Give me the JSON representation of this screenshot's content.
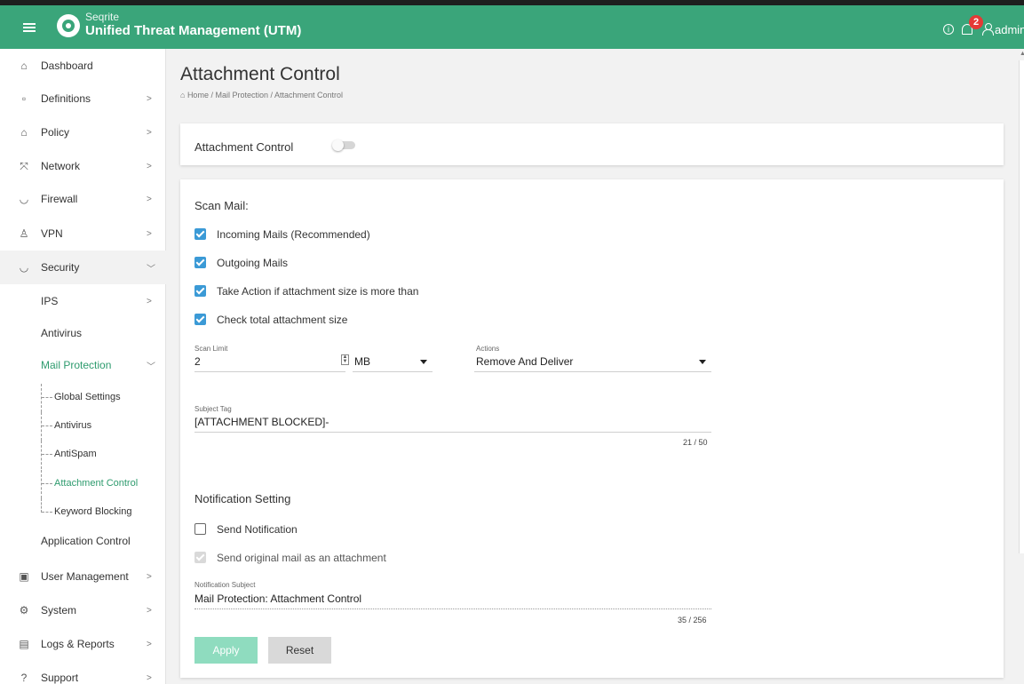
{
  "header": {
    "brand": "Seqrite",
    "product": "Unified Threat Management (UTM)",
    "notification_count": "2",
    "username": "admin",
    "info_glyph": "i"
  },
  "sidebar": {
    "items": [
      {
        "label": "Dashboard",
        "icon": "home-icon"
      },
      {
        "label": "Definitions",
        "icon": "file-icon"
      },
      {
        "label": "Policy",
        "icon": "home-icon"
      },
      {
        "label": "Network",
        "icon": "network-icon"
      },
      {
        "label": "Firewall",
        "icon": "shield-icon"
      },
      {
        "label": "VPN",
        "icon": "vpn-icon"
      },
      {
        "label": "Security",
        "icon": "shield-icon"
      }
    ],
    "security_sub": {
      "ips": "IPS",
      "antivirus": "Antivirus",
      "mail_protection": "Mail Protection",
      "mail_children": [
        "Global Settings",
        "Antivirus",
        "AntiSpam",
        "Attachment Control",
        "Keyword Blocking"
      ],
      "application_control": "Application Control"
    },
    "bottom_items": [
      {
        "label": "User Management",
        "icon": "user-box-icon"
      },
      {
        "label": "System",
        "icon": "gear-icon"
      },
      {
        "label": "Logs & Reports",
        "icon": "report-icon"
      },
      {
        "label": "Support",
        "icon": "help-icon"
      }
    ]
  },
  "page": {
    "title": "Attachment Control",
    "breadcrumb": "Home / Mail Protection / Attachment Control"
  },
  "toggle_card": {
    "label": "Attachment Control",
    "enabled": false
  },
  "scan": {
    "section_title": "Scan Mail:",
    "checkboxes": [
      {
        "label": "Incoming Mails (Recommended)",
        "checked": true
      },
      {
        "label": "Outgoing Mails",
        "checked": true
      },
      {
        "label": "Take Action if attachment size is more than",
        "checked": true
      },
      {
        "label": "Check total attachment size",
        "checked": true
      }
    ],
    "scan_limit_label": "Scan Limit",
    "scan_limit_value": "2",
    "unit": "MB",
    "actions_label": "Actions",
    "actions_value": "Remove And Deliver",
    "subject_tag_label": "Subject Tag",
    "subject_tag_value": "[ATTACHMENT BLOCKED]-",
    "subject_tag_counter": "21 / 50"
  },
  "notification": {
    "section_title": "Notification Setting",
    "send_notification": {
      "label": "Send Notification",
      "checked": false
    },
    "send_original": {
      "label": "Send original mail as an attachment",
      "checked": true,
      "disabled": true
    },
    "subject_label": "Notification Subject",
    "subject_value": "Mail Protection: Attachment Control",
    "subject_counter": "35 / 256"
  },
  "buttons": {
    "apply": "Apply",
    "reset": "Reset"
  },
  "colors": {
    "header": "#3aa57a",
    "accent_green": "#2e9b6e",
    "checkbox_blue": "#3b9ad6",
    "apply_disabled": "#8fdcbf",
    "badge_red": "#e53935"
  }
}
